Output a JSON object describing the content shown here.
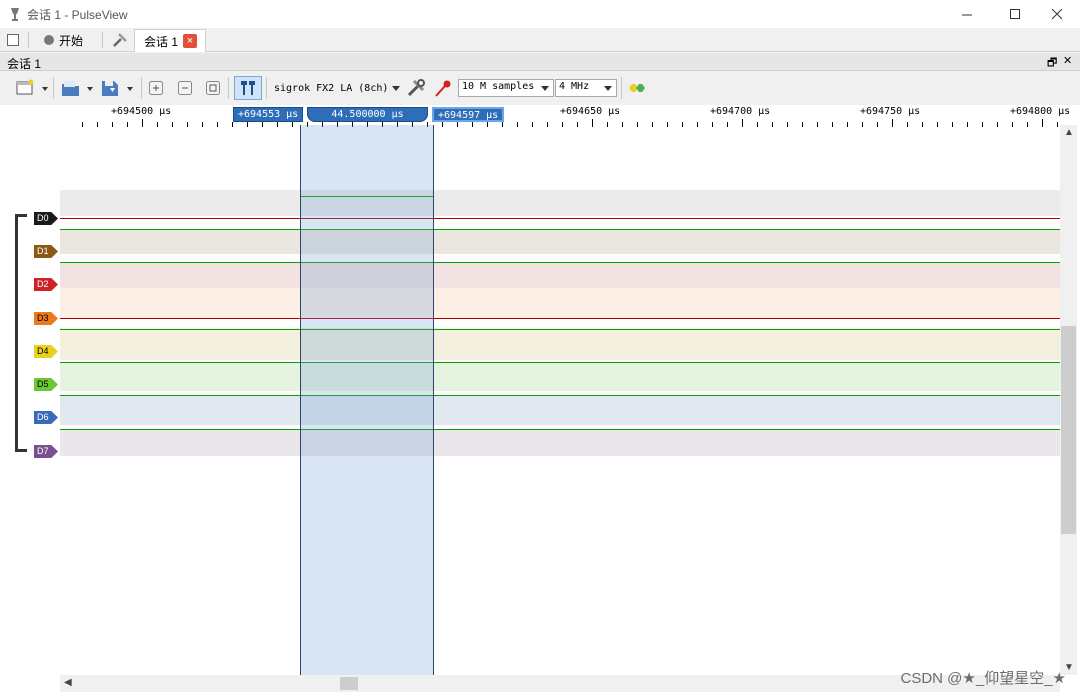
{
  "window": {
    "title": "会话 1 - PulseView",
    "minimize": "—",
    "maximize": "☐",
    "close": "✕"
  },
  "tabbar": {
    "start_label": "开始",
    "session_tab_label": "会话 1",
    "session_tab_close": "×"
  },
  "session": {
    "header_label": "会话 1",
    "float_btn": "🗗",
    "close_btn": "✕"
  },
  "toolbar": {
    "device": "sigrok FX2 LA (8ch)",
    "samples": "10 M samples",
    "rate": "4 MHz"
  },
  "ruler": {
    "major_labels": [
      "+694500 μs",
      "+694650 μs",
      "+694700 μs",
      "+694750 μs",
      "+694800 μs"
    ]
  },
  "cursors": {
    "left": "+694553 μs",
    "width": "44.500000 μs",
    "right": "+694597 μs"
  },
  "channels": [
    {
      "name": "D0",
      "color": "#1a1a1a",
      "lane_bg": "#ebebeb",
      "line_color": "#b00000"
    },
    {
      "name": "D1",
      "color": "#8a5a10",
      "lane_bg": "#ece6e0",
      "line_color": "#00a000"
    },
    {
      "name": "D2",
      "color": "#d0202a",
      "lane_bg": "#f3e2e2",
      "line_color": "#00a000"
    },
    {
      "name": "D3",
      "color": "#ec7a1c",
      "lane_bg": "#fbefe6",
      "line_color": "#b00000"
    },
    {
      "name": "D4",
      "color": "#e8d21e",
      "lane_bg": "#f3f0e0",
      "line_color": "#00a000"
    },
    {
      "name": "D5",
      "color": "#6ec832",
      "lane_bg": "#e6f3e0",
      "line_color": "#00a000"
    },
    {
      "name": "D6",
      "color": "#3a6ab8",
      "lane_bg": "#e2e8f0",
      "line_color": "#00a000"
    },
    {
      "name": "D7",
      "color": "#7a4f90",
      "lane_bg": "#ebe6ec",
      "line_color": "#00a000"
    }
  ],
  "watermark": "CSDN @★_仰望星空_★"
}
